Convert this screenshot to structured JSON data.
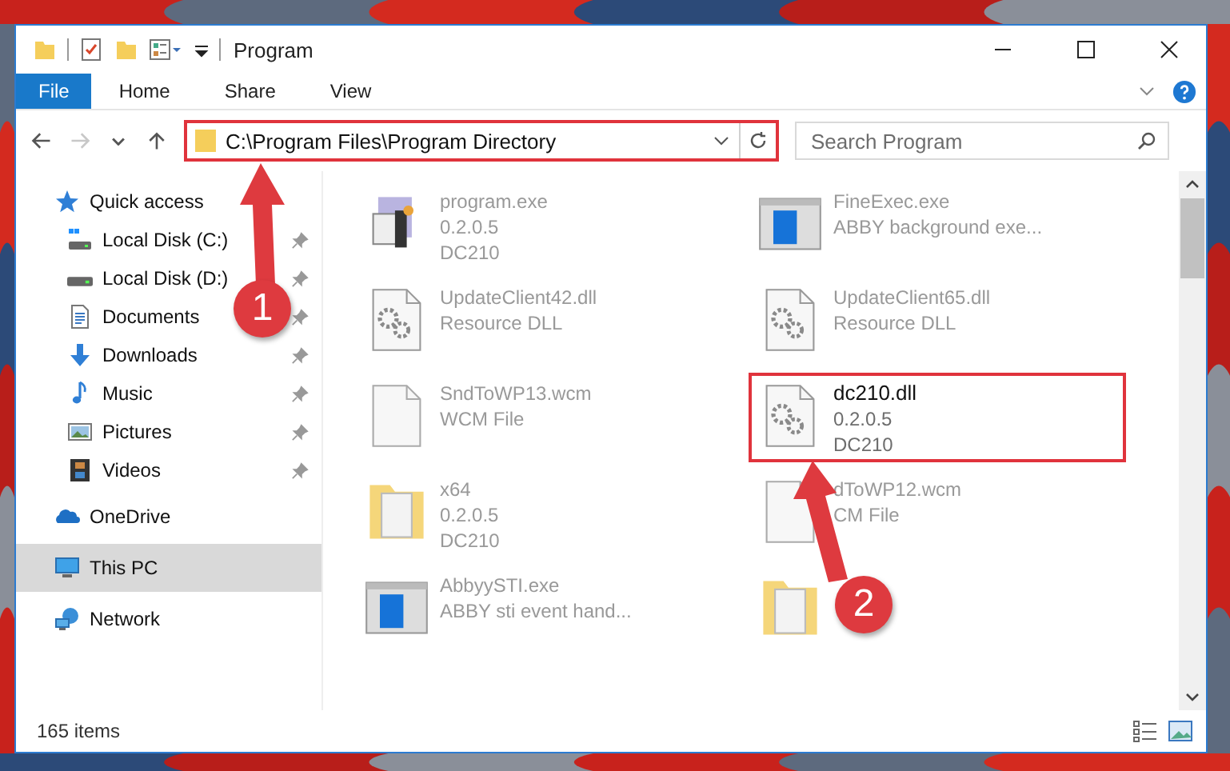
{
  "window": {
    "title": "Program"
  },
  "ribbon": {
    "tabs": [
      {
        "label": "File",
        "selected": true
      },
      {
        "label": "Home",
        "selected": false
      },
      {
        "label": "Share",
        "selected": false
      },
      {
        "label": "View",
        "selected": false
      }
    ]
  },
  "nav_buttons": [
    {
      "kind": "back",
      "disabled": false
    },
    {
      "kind": "forward",
      "disabled": true
    },
    {
      "kind": "recent",
      "disabled": false
    },
    {
      "kind": "up",
      "disabled": false
    }
  ],
  "address_bar": {
    "path": "C:\\Program Files\\Program Directory",
    "highlighted": true
  },
  "search": {
    "placeholder": "Search Program"
  },
  "sidebar": {
    "items": [
      {
        "label": "Quick access",
        "kind": "star",
        "selected": false,
        "children": [
          {
            "label": "Local Disk (C:)",
            "kind": "system-drive",
            "pinned": true,
            "selected": false
          },
          {
            "label": "Local Disk (D:)",
            "kind": "drive",
            "pinned": true,
            "selected": false
          },
          {
            "label": "Documents",
            "kind": "document",
            "pinned": true,
            "selected": false
          },
          {
            "label": "Downloads",
            "kind": "download",
            "pinned": true,
            "selected": false
          },
          {
            "label": "Music",
            "kind": "music",
            "pinned": true,
            "selected": false
          },
          {
            "label": "Pictures",
            "kind": "pictures",
            "pinned": true,
            "selected": false
          },
          {
            "label": "Videos",
            "kind": "film",
            "pinned": true,
            "selected": false
          }
        ]
      },
      {
        "label": "OneDrive",
        "kind": "cloud",
        "selected": false
      },
      {
        "label": "This PC",
        "kind": "pc",
        "selected": true
      },
      {
        "label": "Network",
        "kind": "network",
        "selected": false
      }
    ]
  },
  "files": [
    {
      "name": "program.exe",
      "details": [
        "0.2.0.5",
        "DC210"
      ],
      "kind": "installer",
      "highlighted": false
    },
    {
      "name": "FineExec.exe",
      "details": [
        "ABBY background exe..."
      ],
      "kind": "window",
      "highlighted": false
    },
    {
      "name": "UpdateClient42.dll",
      "details": [
        "Resource DLL"
      ],
      "kind": "dll",
      "highlighted": false
    },
    {
      "name": "UpdateClient65.dll",
      "details": [
        "Resource DLL"
      ],
      "kind": "dll",
      "highlighted": false
    },
    {
      "name": "SndToWP13.wcm",
      "details": [
        "WCM File"
      ],
      "kind": "blank",
      "highlighted": false
    },
    {
      "name": "dc210.dll",
      "details": [
        "0.2.0.5",
        "DC210"
      ],
      "kind": "dll",
      "highlighted": true
    },
    {
      "name": "x64",
      "details": [
        "0.2.0.5",
        "DC210"
      ],
      "kind": "folder",
      "highlighted": false
    },
    {
      "name": "dToWP12.wcm",
      "details": [
        "CM File"
      ],
      "kind": "blank",
      "highlighted": false
    },
    {
      "name": "AbbyySTI.exe",
      "details": [
        "ABBY sti event hand..."
      ],
      "kind": "window",
      "highlighted": false
    },
    {
      "kind": "folder",
      "highlighted": false
    }
  ],
  "status_bar": {
    "item_count": "165 items"
  },
  "annotations": [
    {
      "number": "1"
    },
    {
      "number": "2"
    }
  ]
}
